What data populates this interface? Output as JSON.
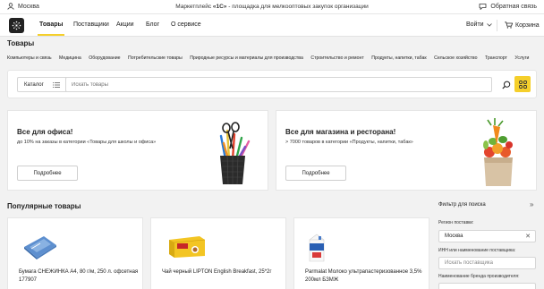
{
  "topbar": {
    "city": "Москва",
    "promo_prefix": "Маркетплейс ",
    "promo_brand": "«1С»",
    "promo_suffix": " - площадка для мелкооптовых закупок организации",
    "feedback": "Обратная связь"
  },
  "nav": {
    "tabs": [
      {
        "label": "Товары",
        "active": true
      },
      {
        "label": "Поставщики"
      },
      {
        "label": "Акции"
      },
      {
        "label": "Блог"
      },
      {
        "label": "О сервисе"
      }
    ],
    "login": "Войти",
    "cart": "Корзина"
  },
  "page_title": "Товары",
  "categories": [
    "Компьютеры и связь",
    "Медицина",
    "Оборудование",
    "Потребительские товары",
    "Природные ресурсы и материалы для производства",
    "Строительство и ремонт",
    "Продукты, напитки, табак",
    "Сельское хозяйство",
    "Транспорт",
    "Услуги"
  ],
  "search": {
    "catalog_label": "Каталог",
    "placeholder": "Искать товары"
  },
  "banners": [
    {
      "title": "Все для офиса!",
      "text": "до 10% на заказы в категории «Товары для школы и офиса»",
      "button": "Подробнее"
    },
    {
      "title": "Все для магазина и ресторана!",
      "text": "> 7000 товаров в категории «Продукты, напитки, табак»",
      "button": "Подробнее"
    }
  ],
  "popular": {
    "title": "Популярные товары",
    "items": [
      {
        "name": "Бумага СНЕЖИНКА А4, 80 г/м, 250 л. офсетная 177907"
      },
      {
        "name": "Чай черный LIPTON English Breakfast, 25*2г"
      },
      {
        "name": "Parmalat Молоко ультрапастеризованное 3,5% 200мл БЗМЖ"
      }
    ]
  },
  "filter": {
    "title": "Фильтр для поиска",
    "region_label": "Регион поставки:",
    "region_value": "Москва",
    "inn_label": "ИНН или наименование поставщика:",
    "inn_placeholder": "Искать поставщика",
    "brand_label": "Наименование бренда производителя:"
  },
  "colors": {
    "accent": "#f5cf2b",
    "background": "#f2f2f2"
  }
}
